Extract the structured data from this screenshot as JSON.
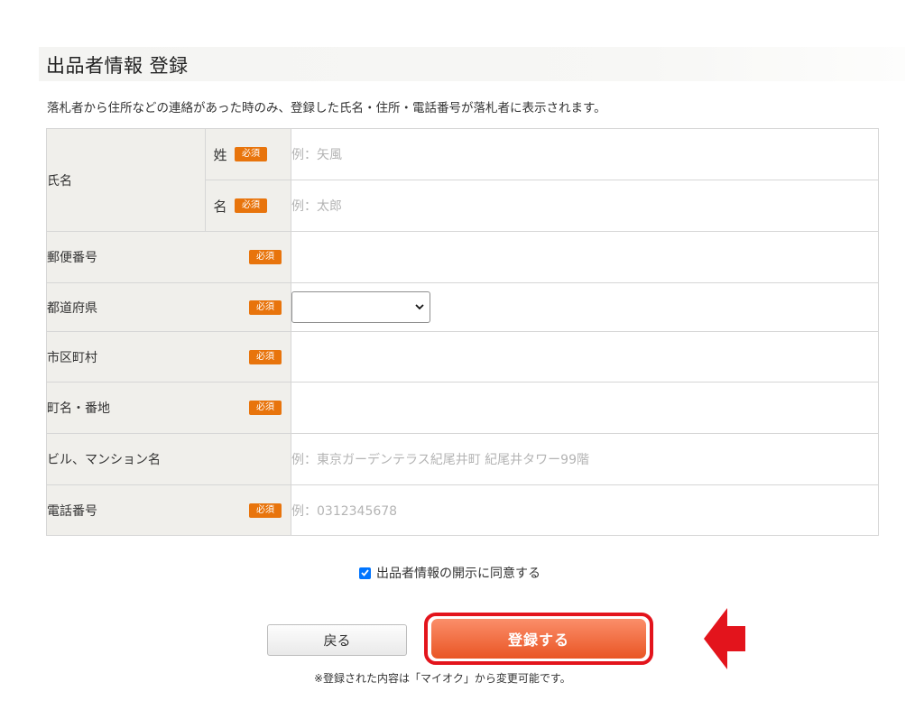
{
  "page": {
    "title": "出品者情報 登録",
    "intro": "落札者から住所などの連絡があった時のみ、登録した氏名・住所・電話番号が落札者に表示されます。"
  },
  "required_badge": "必須",
  "form": {
    "name": {
      "label": "氏名",
      "last": {
        "label": "姓",
        "placeholder": "例：矢風"
      },
      "first": {
        "label": "名",
        "placeholder": "例：太郎"
      }
    },
    "postal": {
      "label": "郵便番号",
      "value": ""
    },
    "prefecture": {
      "label": "都道府県",
      "selected": ""
    },
    "city": {
      "label": "市区町村",
      "value": ""
    },
    "street": {
      "label": "町名・番地",
      "value": ""
    },
    "building": {
      "label": "ビル、マンション名",
      "placeholder": "例：東京ガーデンテラス紀尾井町 紀尾井タワー99階"
    },
    "phone": {
      "label": "電話番号",
      "placeholder": "例：0312345678"
    }
  },
  "agree": {
    "label": "出品者情報の開示に同意する",
    "checked": true
  },
  "buttons": {
    "back": "戻る",
    "submit": "登録する"
  },
  "note": "※登録された内容は「マイオク」から変更可能です。",
  "colors": {
    "badge": "#e8740c",
    "submit": "#ee6a3f",
    "highlight": "#e3141c",
    "label_bg": "#f0efeb"
  }
}
